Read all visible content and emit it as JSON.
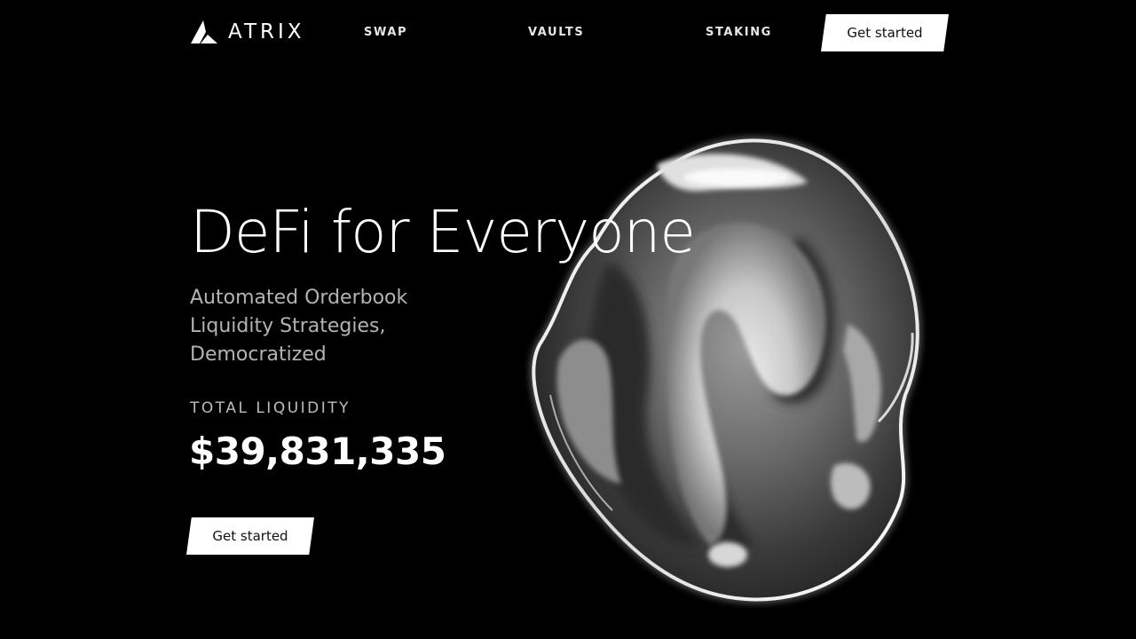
{
  "brand": {
    "name": "ATRIX",
    "logo_icon": "atrix-triangle-logo-icon"
  },
  "nav": {
    "items": [
      {
        "label": "SWAP"
      },
      {
        "label": "VAULTS"
      },
      {
        "label": "STAKING"
      }
    ],
    "cta_label": "Get started"
  },
  "hero": {
    "title": "DeFi for Everyone",
    "subtitle_lines": [
      "Automated Orderbook",
      "Liquidity Strategies,",
      "Democratized"
    ],
    "stat_label": "TOTAL LIQUIDITY",
    "stat_value": "$39,831,335",
    "cta_label": "Get started"
  },
  "colors": {
    "background": "#000000",
    "text_primary": "#ffffff",
    "text_secondary": "#b3b3b3",
    "button_bg": "#ffffff",
    "button_text": "#111111"
  },
  "decoration": {
    "hero_image": "chrome-liquid-blob"
  }
}
